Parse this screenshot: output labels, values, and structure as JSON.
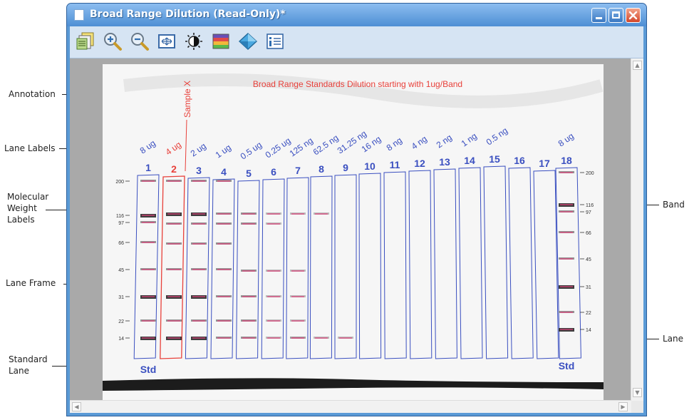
{
  "window": {
    "title": "Broad Range Dilution (Read-Only)*"
  },
  "toolbar": {
    "buttons": [
      "gel-properties-icon",
      "zoom-in-icon",
      "zoom-out-icon",
      "fit-to-window-icon",
      "contrast-icon",
      "color-palette-icon",
      "lane-detection-icon",
      "information-icon"
    ]
  },
  "callouts": {
    "annotation": "Annotation",
    "lane_labels": "Lane Labels",
    "mw_labels": [
      "Molecular",
      "Weight",
      "Labels"
    ],
    "lane_frame": "Lane Frame",
    "standard_lane": [
      "Standard",
      "Lane"
    ],
    "band": "Band",
    "lane": "Lane"
  },
  "gel": {
    "annotation_title": "Broad Range Standards Dilution starting with 1ug/Band",
    "sample_annotation": "Sample X",
    "lane_numbers": [
      "1",
      "2",
      "3",
      "4",
      "5",
      "6",
      "7",
      "8",
      "9",
      "10",
      "11",
      "12",
      "13",
      "14",
      "15",
      "16",
      "17",
      "18"
    ],
    "lane_loads": [
      "8 ug",
      "4 ug",
      "2 ug",
      "1 ug",
      "0.5 ug",
      "0.25 ug",
      "125 ng",
      "62.5 ng",
      "31.25 ng",
      "16 ng",
      "8 ng",
      "4 ng",
      "2 ng",
      "1 ng",
      "0.5 ng",
      "",
      "",
      "8 ug"
    ],
    "selected_lane": "2",
    "std_label_left": "Std",
    "std_label_right": "Std",
    "mw_left": [
      "200",
      "116",
      "97",
      "66",
      "45",
      "31",
      "22",
      "14"
    ],
    "mw_right": [
      "200",
      "116",
      "97",
      "66",
      "45",
      "31",
      "22",
      "14"
    ]
  },
  "colors": {
    "lane_frame": "#3a4fc0",
    "lane_label": "#3a4fc0",
    "selected": "#e8403a",
    "band_mark": "#e0407a",
    "title_bar": "#4e8fd4"
  }
}
